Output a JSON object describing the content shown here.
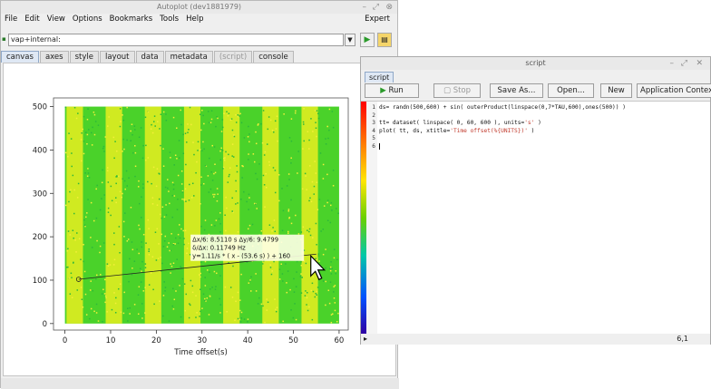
{
  "main_window": {
    "title": "Autoplot (dev1881979)",
    "menus": [
      "File",
      "Edit",
      "View",
      "Options",
      "Bookmarks",
      "Tools",
      "Help"
    ],
    "expert": "Expert",
    "uri_value": "vap+internal:",
    "tabs": [
      "canvas",
      "axes",
      "style",
      "layout",
      "data",
      "metadata",
      "(script)",
      "console"
    ],
    "active_tab": "canvas"
  },
  "plot": {
    "xlabel": "Time offset(s)",
    "y_ticks": [
      0,
      100,
      200,
      300,
      400,
      500
    ],
    "x_ticks": [
      0,
      10,
      20,
      30,
      40,
      50,
      60
    ],
    "stripe_count": 7,
    "annotation": {
      "line1": "Δx/6: 8.5110 s Δy/6: 9.4799",
      "line2": "δ/Δx: 0.11749 Hz",
      "line3": "y=1.11/s * ( x - (53.6 s) ) + 160"
    },
    "fit_line": {
      "x0": 3,
      "y0": 102,
      "x1": 55,
      "y1": 160
    }
  },
  "chart_data": {
    "type": "heatmap",
    "xlabel": "Time offset(s)",
    "ylabel": "",
    "xlim": [
      -2.5,
      62
    ],
    "ylim": [
      -15,
      520
    ],
    "x_ticks": [
      0,
      10,
      20,
      30,
      40,
      50,
      60
    ],
    "y_ticks": [
      0,
      100,
      200,
      300,
      400,
      500
    ]
  },
  "script_window": {
    "title": "script",
    "tab": "script",
    "buttons": {
      "run": "Run",
      "stop": "Stop",
      "save_as": "Save As...",
      "open": "Open...",
      "new": "New",
      "context": "Application Context"
    },
    "code_lines": [
      {
        "num": "1",
        "parts": [
          {
            "t": "ds= randn(500,600) + sin( outerProduct(linspace(0,7*TAU,600),ones(500)) )",
            "s": false
          }
        ]
      },
      {
        "num": "2",
        "parts": []
      },
      {
        "num": "3",
        "parts": [
          {
            "t": "tt= dataset( linspace( 0, 60, 600 ), units=",
            "s": false
          },
          {
            "t": "'s'",
            "s": true
          },
          {
            "t": " )",
            "s": false
          }
        ]
      },
      {
        "num": "4",
        "parts": [
          {
            "t": "plot( tt, ds, xtitle=",
            "s": false
          },
          {
            "t": "'Time offset(%{UNITS})'",
            "s": true
          },
          {
            "t": " )",
            "s": false
          }
        ]
      },
      {
        "num": "5",
        "parts": []
      },
      {
        "num": "6",
        "parts": [],
        "caret": true
      }
    ],
    "cursor_pos": "6,1",
    "collapse_arrow": "▸"
  },
  "colors": {
    "heat_green": "#4ad22a",
    "heat_yellow": "#e8ee20",
    "annotation_bg": "#ffffe6"
  }
}
